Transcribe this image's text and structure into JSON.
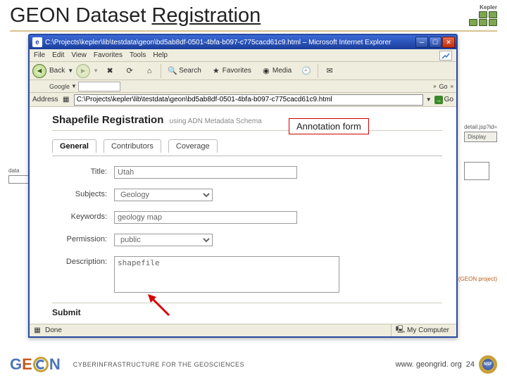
{
  "slide": {
    "title_plain": "GEON Dataset ",
    "title_underlined": "Registration",
    "footer_sub": "CYBERINFRASTRUCTURE FOR THE GEOSCIENCES",
    "footer_url": "www. geongrid. org",
    "page_num": "24",
    "kepler_label": "Kepler"
  },
  "callout": "Annotation form",
  "ie": {
    "title": "C:\\Projects\\kepler\\lib\\testdata\\geon\\bd5ab8df-0501-4bfa-b097-c775cacd61c9.html – Microsoft Internet Explorer",
    "menu": {
      "file": "File",
      "edit": "Edit",
      "view": "View",
      "favorites": "Favorites",
      "tools": "Tools",
      "help": "Help"
    },
    "toolbar": {
      "back": "Back",
      "search": "Search",
      "favorites": "Favorites",
      "media": "Media",
      "google": "Google"
    },
    "toolbar2": {
      "go_right": "Go"
    },
    "address_label": "Address",
    "address_value": "C:\\Projects\\kepler\\lib\\testdata\\geon\\bd5ab8df-0501-4bfa-b097-c775cacd61c9.html",
    "go": "Go",
    "status_done": "Done",
    "status_zone": "My Computer"
  },
  "form": {
    "heading": "Shapefile Registration",
    "heading_sub": "using ADN Metadata Schema",
    "tabs": {
      "general": "General",
      "contributors": "Contributors",
      "coverage": "Coverage"
    },
    "labels": {
      "title": "Title:",
      "subjects": "Subjects:",
      "keywords": "Keywords:",
      "permission": "Permission:",
      "description": "Description:"
    },
    "values": {
      "title": "Utah",
      "subjects": "Geology",
      "keywords": "geology map",
      "permission": "public",
      "description": "shapefile"
    },
    "submit": "Submit"
  },
  "behind": {
    "right_lbl": "detail.jsp?id=",
    "right_btn": "Display",
    "right_note": "(GEON project)",
    "left_lbl": "data"
  }
}
